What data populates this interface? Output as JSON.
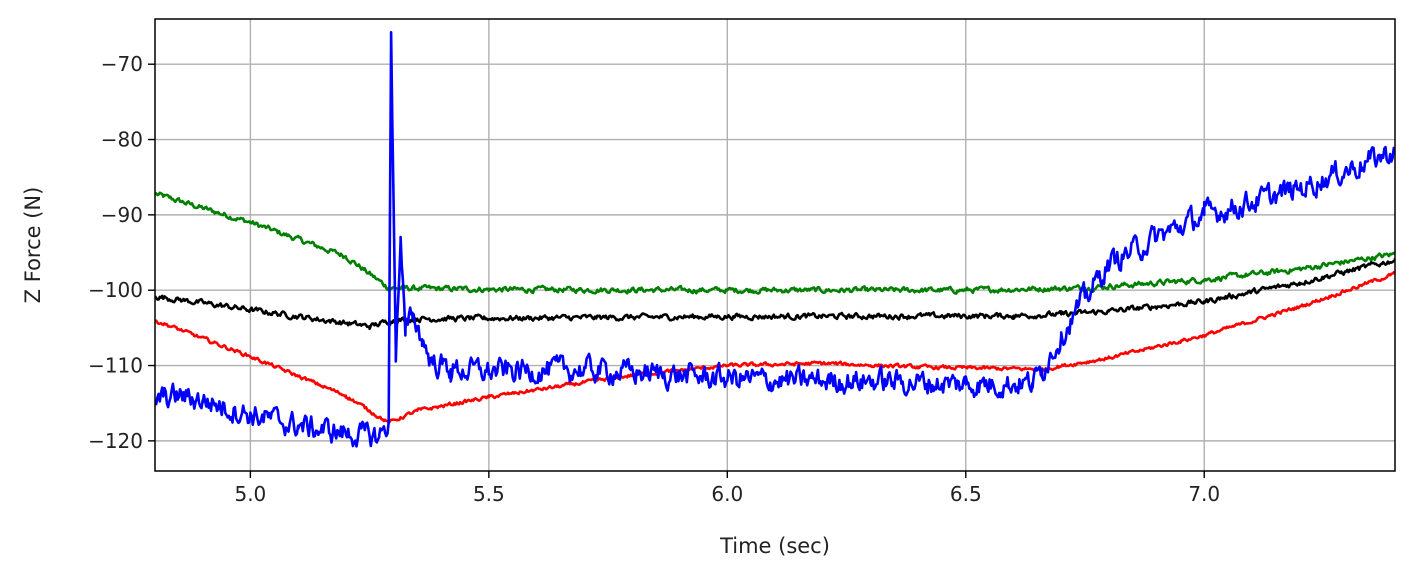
{
  "chart_data": {
    "type": "line",
    "xlabel": "Time (sec)",
    "ylabel": "Z Force (N)",
    "xlim": [
      4.8,
      7.4
    ],
    "ylim": [
      -124,
      -64
    ],
    "xticks": [
      5.0,
      5.5,
      6.0,
      6.5,
      7.0
    ],
    "xtick_labels": [
      "5.0",
      "5.5",
      "6.0",
      "6.5",
      "7.0"
    ],
    "yticks": [
      -70,
      -80,
      -90,
      -100,
      -110,
      -120
    ],
    "ytick_labels": [
      "−70",
      "−80",
      "−90",
      "−100",
      "−110",
      "−120"
    ],
    "grid": true,
    "legend": "none",
    "series": [
      {
        "color": "#008000",
        "noise": 0.3,
        "points": [
          [
            4.8,
            -87.2
          ],
          [
            5.0,
            -91.0
          ],
          [
            5.2,
            -95.5
          ],
          [
            5.29,
            -99.7
          ],
          [
            5.5,
            -99.9
          ],
          [
            6.0,
            -100.0
          ],
          [
            6.5,
            -100.0
          ],
          [
            6.75,
            -99.7
          ],
          [
            7.0,
            -98.6
          ],
          [
            7.2,
            -97.2
          ],
          [
            7.4,
            -95.2
          ]
        ]
      },
      {
        "color": "#000000",
        "noise": 0.3,
        "points": [
          [
            4.8,
            -100.8
          ],
          [
            5.0,
            -102.6
          ],
          [
            5.25,
            -104.8
          ],
          [
            5.3,
            -104.0
          ],
          [
            5.35,
            -103.8
          ],
          [
            6.0,
            -103.5
          ],
          [
            6.6,
            -103.4
          ],
          [
            6.7,
            -103.2
          ],
          [
            6.8,
            -102.8
          ],
          [
            7.0,
            -101.5
          ],
          [
            7.2,
            -99.0
          ],
          [
            7.4,
            -96.0
          ]
        ]
      },
      {
        "color": "#ff0000",
        "noise": 0.2,
        "points": [
          [
            4.8,
            -104.0
          ],
          [
            5.0,
            -108.8
          ],
          [
            5.2,
            -114.0
          ],
          [
            5.29,
            -117.6
          ],
          [
            5.35,
            -116.0
          ],
          [
            5.5,
            -114.2
          ],
          [
            5.8,
            -111.3
          ],
          [
            6.0,
            -110.0
          ],
          [
            6.2,
            -109.7
          ],
          [
            6.4,
            -110.2
          ],
          [
            6.66,
            -110.5
          ],
          [
            6.8,
            -109.0
          ],
          [
            7.0,
            -106.0
          ],
          [
            7.2,
            -102.2
          ],
          [
            7.4,
            -97.8
          ]
        ]
      },
      {
        "color": "#0000ff",
        "noise": 1.3,
        "points": [
          [
            4.8,
            -114.5
          ],
          [
            4.85,
            -114.0
          ],
          [
            4.9,
            -114.6
          ],
          [
            5.0,
            -116.5
          ],
          [
            5.1,
            -118.0
          ],
          [
            5.2,
            -119.0
          ],
          [
            5.27,
            -119.5
          ],
          [
            5.29,
            -117.5
          ],
          [
            5.295,
            -66.5
          ],
          [
            5.305,
            -108.0
          ],
          [
            5.315,
            -93.5
          ],
          [
            5.325,
            -106.0
          ],
          [
            5.34,
            -103.0
          ],
          [
            5.36,
            -106.5
          ],
          [
            5.38,
            -109.5
          ],
          [
            5.42,
            -110.5
          ],
          [
            5.5,
            -110.8
          ],
          [
            5.7,
            -110.5
          ],
          [
            5.9,
            -111.3
          ],
          [
            6.1,
            -112.0
          ],
          [
            6.3,
            -112.0
          ],
          [
            6.5,
            -112.5
          ],
          [
            6.64,
            -112.3
          ],
          [
            6.66,
            -110.5
          ],
          [
            6.7,
            -106.0
          ],
          [
            6.75,
            -101.0
          ],
          [
            6.8,
            -96.5
          ],
          [
            6.9,
            -93.0
          ],
          [
            7.0,
            -90.0
          ],
          [
            7.1,
            -88.3
          ],
          [
            7.2,
            -86.5
          ],
          [
            7.3,
            -84.0
          ],
          [
            7.4,
            -81.5
          ]
        ]
      }
    ]
  }
}
